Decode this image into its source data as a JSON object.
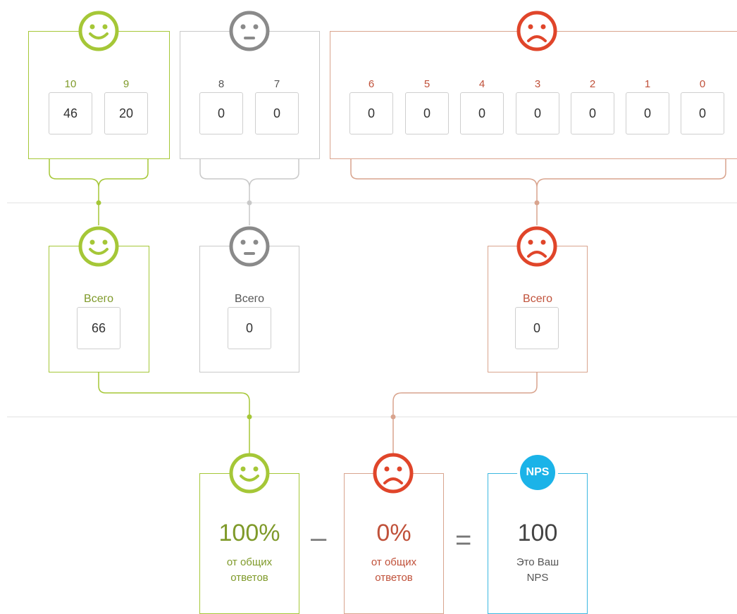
{
  "promoters_group": {
    "scores": [
      {
        "label": "10",
        "value": "46"
      },
      {
        "label": "9",
        "value": "20"
      }
    ]
  },
  "passives_group": {
    "scores": [
      {
        "label": "8",
        "value": "0"
      },
      {
        "label": "7",
        "value": "0"
      }
    ]
  },
  "detractors_group": {
    "scores": [
      {
        "label": "6",
        "value": "0"
      },
      {
        "label": "5",
        "value": "0"
      },
      {
        "label": "4",
        "value": "0"
      },
      {
        "label": "3",
        "value": "0"
      },
      {
        "label": "2",
        "value": "0"
      },
      {
        "label": "1",
        "value": "0"
      },
      {
        "label": "0",
        "value": "0"
      }
    ]
  },
  "totals": {
    "promoters": {
      "label": "Всего",
      "value": "66"
    },
    "passives": {
      "label": "Всего",
      "value": "0"
    },
    "detractors": {
      "label": "Всего",
      "value": "0"
    }
  },
  "result": {
    "promoters_percent": "100%",
    "promoters_caption": "от общих ответов",
    "minus": "–",
    "detractors_percent": "0%",
    "detractors_caption": "от общих ответов",
    "equals": "=",
    "nps_badge": "NPS",
    "nps_value": "100",
    "nps_caption": "Это Ваш NPS"
  },
  "colors": {
    "promoter": "#a5c737",
    "passive": "#8a8a8a",
    "detractor": "#e0452a",
    "nps": "#1bb3e8"
  },
  "icons": {
    "promoter": "happy-face-icon",
    "passive": "neutral-face-icon",
    "detractor": "sad-face-icon"
  }
}
